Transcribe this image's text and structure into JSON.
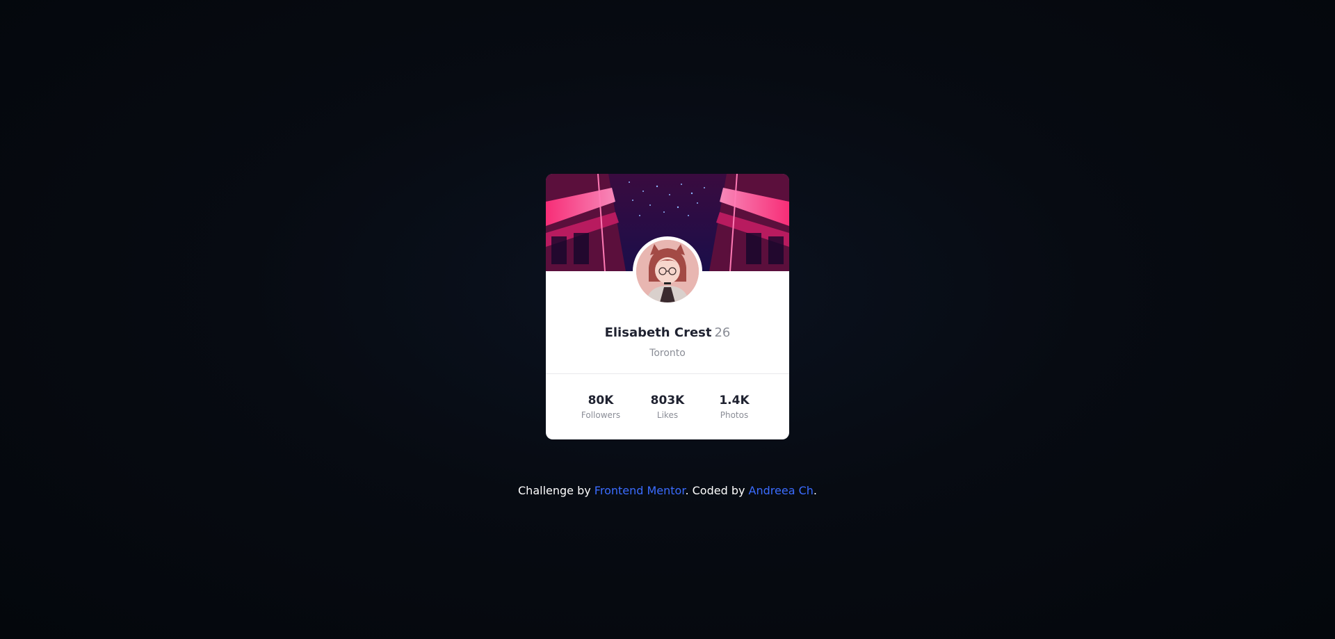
{
  "profile": {
    "name": "Elisabeth Crest",
    "age": "26",
    "city": "Toronto"
  },
  "stats": [
    {
      "value": "80K",
      "label": "Followers"
    },
    {
      "value": "803K",
      "label": "Likes"
    },
    {
      "value": "1.4K",
      "label": "Photos"
    }
  ],
  "footer": {
    "prefix": "Challenge by ",
    "link1": "Frontend Mentor",
    "middle": ". Coded by ",
    "link2": "Andreea Ch",
    "suffix": "."
  },
  "colors": {
    "background": "#04070c",
    "card": "#ffffff",
    "text_dark": "#1f2230",
    "text_muted": "#8a8d96",
    "link": "#3b6cff",
    "neon_pink": "#ff4d94"
  },
  "icons": {
    "banner": "neon-train-interior-image",
    "avatar": "anime-girl-avatar-image"
  }
}
